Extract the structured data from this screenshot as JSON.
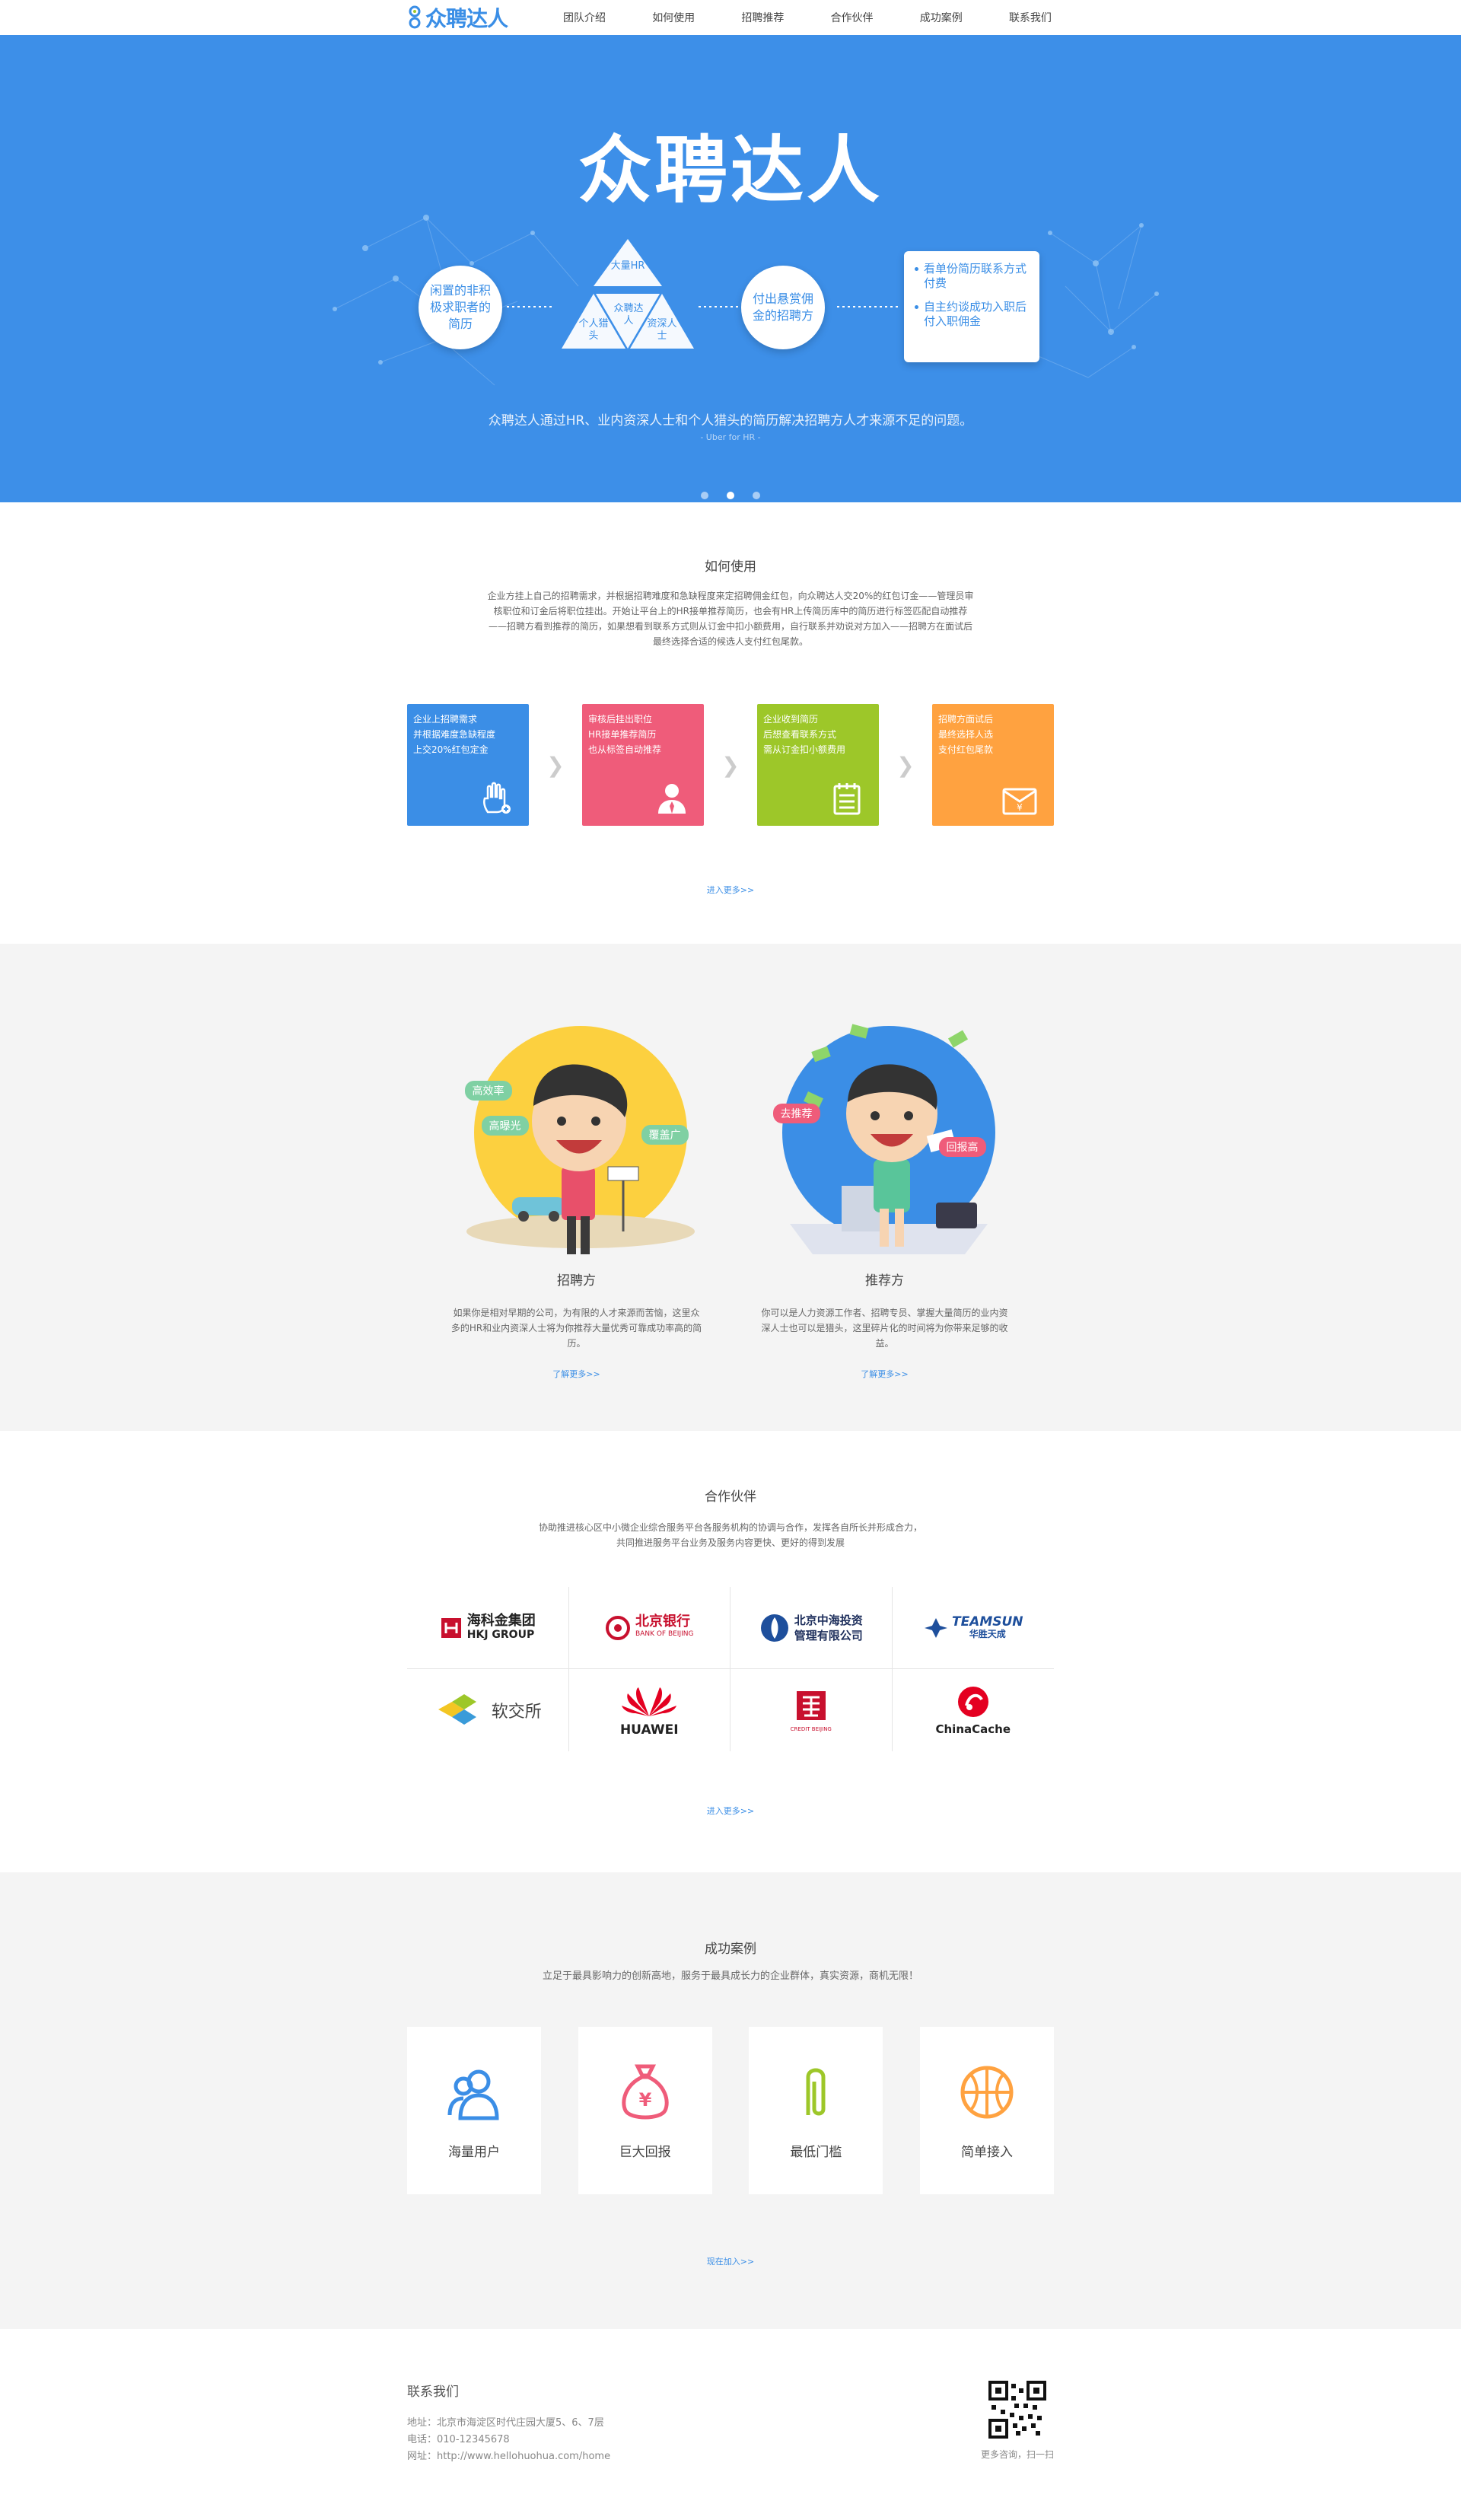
{
  "nav": {
    "logo_text": "众聘达人",
    "items": [
      "团队介绍",
      "如何使用",
      "招聘推荐",
      "合作伙伴",
      "成功案例",
      "联系我们"
    ]
  },
  "hero": {
    "title": "众聘达人",
    "bubble_left": "闲置的非积极求职者的简历",
    "tri_top": "大量HR",
    "tri_left": "个人猎头",
    "tri_center": "众聘达人",
    "tri_right": "资深人士",
    "bubble_right": "付出悬赏佣金的招聘方",
    "card_items": [
      "看单份简历联系方式付费",
      "自主约谈成功入职后付入职佣金"
    ],
    "desc": "众聘达人通过HR、业内资深人士和个人猎头的简历解决招聘方人才来源不足的问题。",
    "sub": "- Uber for HR -",
    "slides": 3,
    "active_slide": 1
  },
  "how": {
    "title": "如何使用",
    "text": "企业方挂上自己的招聘需求，并根据招聘难度和急缺程度来定招聘佣金红包，向众聘达人交20%的红包订金——管理员审核职位和订金后将职位挂出。开始让平台上的HR接单推荐简历，也会有HR上传简历库中的简历进行标签匹配自动推荐——招聘方看到推荐的简历，如果想看到联系方式则从订金中扣小额费用，自行联系并劝说对方加入——招聘方在面试后最终选择合适的候选人支付红包尾款。",
    "steps": [
      {
        "text": "企业上招聘需求\n并根据难度急缺程度\n上交20%红包定金",
        "color": "#3b8ee6"
      },
      {
        "text": "审核后挂出职位\nHR接单推荐简历\n也从标签自动推荐",
        "color": "#ef5c7a"
      },
      {
        "text": "企业收到简历\n后想查看联系方式\n需从订金扣小额费用",
        "color": "#9dc729"
      },
      {
        "text": "招聘方面试后\n最终选择人选\n支付红包尾款",
        "color": "#ffa240"
      }
    ],
    "more": "进入更多>>"
  },
  "roles": {
    "items": [
      {
        "title": "招聘方",
        "text": "如果你是相对早期的公司，为有限的人才来源而苦恼，这里众多的HR和业内资深人士将为你推荐大量优秀可靠成功率高的简历。",
        "more": "了解更多>>",
        "tags": [
          "高效率",
          "高曝光",
          "覆盖广"
        ]
      },
      {
        "title": "推荐方",
        "text": "你可以是人力资源工作者、招聘专员、掌握大量简历的业内资深人士也可以是猎头，这里碎片化的时间将为你带来足够的收益。",
        "more": "了解更多>>",
        "tags": [
          "去推荐",
          "回报高"
        ]
      }
    ]
  },
  "partners": {
    "title": "合作伙伴",
    "text1": "协助推进核心区中小微企业综合服务平台各服务机构的协调与合作，发挥各自所长并形成合力，",
    "text2": "共同推进服务平台业务及服务内容更快、更好的得到发展",
    "logos": [
      {
        "main": "海科金集团",
        "sub": "HKJ GROUP"
      },
      {
        "main": "北京银行",
        "sub": "BANK OF BEIJING"
      },
      {
        "main": "北京中海投资",
        "sub": "管理有限公司"
      },
      {
        "main": "TEAMSUN",
        "sub": "华胜天成"
      },
      {
        "main": "软交所",
        "sub": ""
      },
      {
        "main": "HUAWEI",
        "sub": ""
      },
      {
        "main": "",
        "sub": "CREDIT BEIJING"
      },
      {
        "main": "ChinaCache",
        "sub": ""
      }
    ],
    "more": "进入更多>>"
  },
  "cases": {
    "title": "成功案例",
    "text": "立足于最具影响力的创新高地，服务于最具成长力的企业群体，真实资源，商机无限！",
    "items": [
      "海量用户",
      "巨大回报",
      "最低门槛",
      "简单接入"
    ],
    "more": "现在加入>>"
  },
  "contact": {
    "title": "联系我们",
    "address": "地址：北京市海淀区时代庄园大厦5、6、7层",
    "phone": "电话：010-12345678",
    "website": "网址：http://www.hellohuohua.com/home",
    "qr_caption": "更多咨询，扫一扫"
  },
  "colors": {
    "brand_blue": "#3d8fe8",
    "step_blue": "#3b8ee6",
    "step_pink": "#ef5c7a",
    "step_green": "#9dc729",
    "step_orange": "#ffa240"
  }
}
